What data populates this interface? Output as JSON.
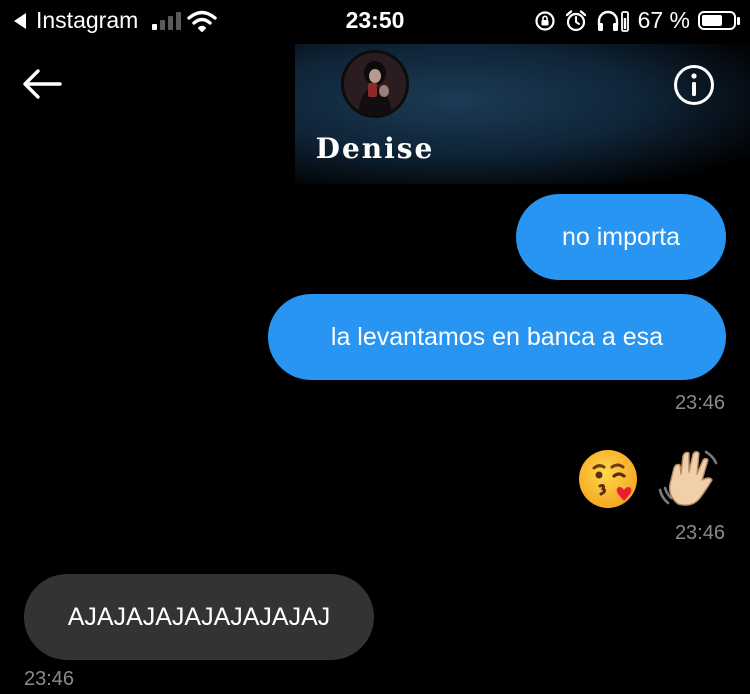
{
  "status_bar": {
    "back_app": "Instagram",
    "time": "23:50",
    "battery_percent": "67 %",
    "battery_level": 0.67,
    "signal_bars_active": 1,
    "signal_bars_total": 4
  },
  "header": {
    "contact_name": "Denise",
    "back_icon": "arrow-left-icon",
    "info_icon": "info-icon"
  },
  "messages": [
    {
      "direction": "sent",
      "text": "no importa"
    },
    {
      "direction": "sent",
      "text": "la levantamos en banca a esa"
    },
    {
      "timestamp": "23:46"
    },
    {
      "direction": "sent",
      "emoji": [
        "kissing-heart-emoji",
        "waving-hand-emoji"
      ]
    },
    {
      "timestamp": "23:46"
    },
    {
      "direction": "received",
      "text": "AJAJAJAJAJAJAJAJAJ"
    },
    {
      "timestamp": "23:46"
    }
  ],
  "colors": {
    "sent_bubble": "#2795f1",
    "received_bubble": "#333336",
    "background": "#000000",
    "timestamp": "#8a8a8e"
  }
}
